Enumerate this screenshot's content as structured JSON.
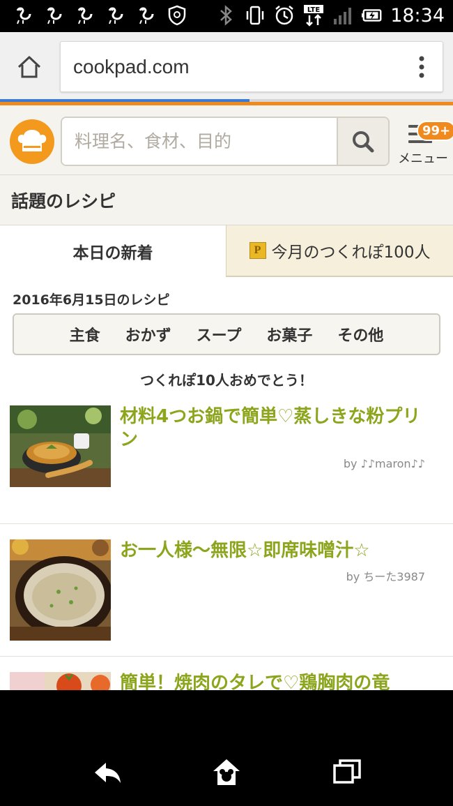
{
  "status_bar": {
    "time": "18:34",
    "network": "LTE"
  },
  "browser": {
    "url": "cookpad.com",
    "load_progress": 0.55
  },
  "header": {
    "search_placeholder": "料理名、食材、目的",
    "menu_label": "メニュー",
    "menu_badge": "99+"
  },
  "section_title": "話題のレシピ",
  "tabs": {
    "active": "本日の新着",
    "inactive": "今月のつくれぽ100人",
    "inactive_icon_letter": "P"
  },
  "date_label": "2016年6月15日のレシピ",
  "categories": [
    "主食",
    "おかず",
    "スープ",
    "お菓子",
    "その他"
  ],
  "congrats": "つくれぽ10人おめでとう！",
  "recipes": [
    {
      "title": "材料4つお鍋で簡単♡蒸しきな粉プリン",
      "author": "by ♪♪maron♪♪"
    },
    {
      "title": "お一人様～無限☆即席味噌汁☆",
      "author": "by ちーた3987"
    },
    {
      "title": "簡単！焼肉のタレで♡鶏胸肉の竜",
      "author": ""
    }
  ],
  "colors": {
    "accent_orange": "#f08a1e",
    "recipe_title_green": "#8ba51c",
    "progress_blue": "#3a7bd5"
  },
  "icons": {
    "status": [
      "bird-icon",
      "bird-icon",
      "bird-icon",
      "bird-icon",
      "bird-icon",
      "shield-icon",
      "bluetooth-icon",
      "vibrate-icon",
      "alarm-icon",
      "lte-icon",
      "signal-icon",
      "battery-icon"
    ],
    "nav": [
      "back-icon",
      "home-icon",
      "recents-icon"
    ]
  }
}
